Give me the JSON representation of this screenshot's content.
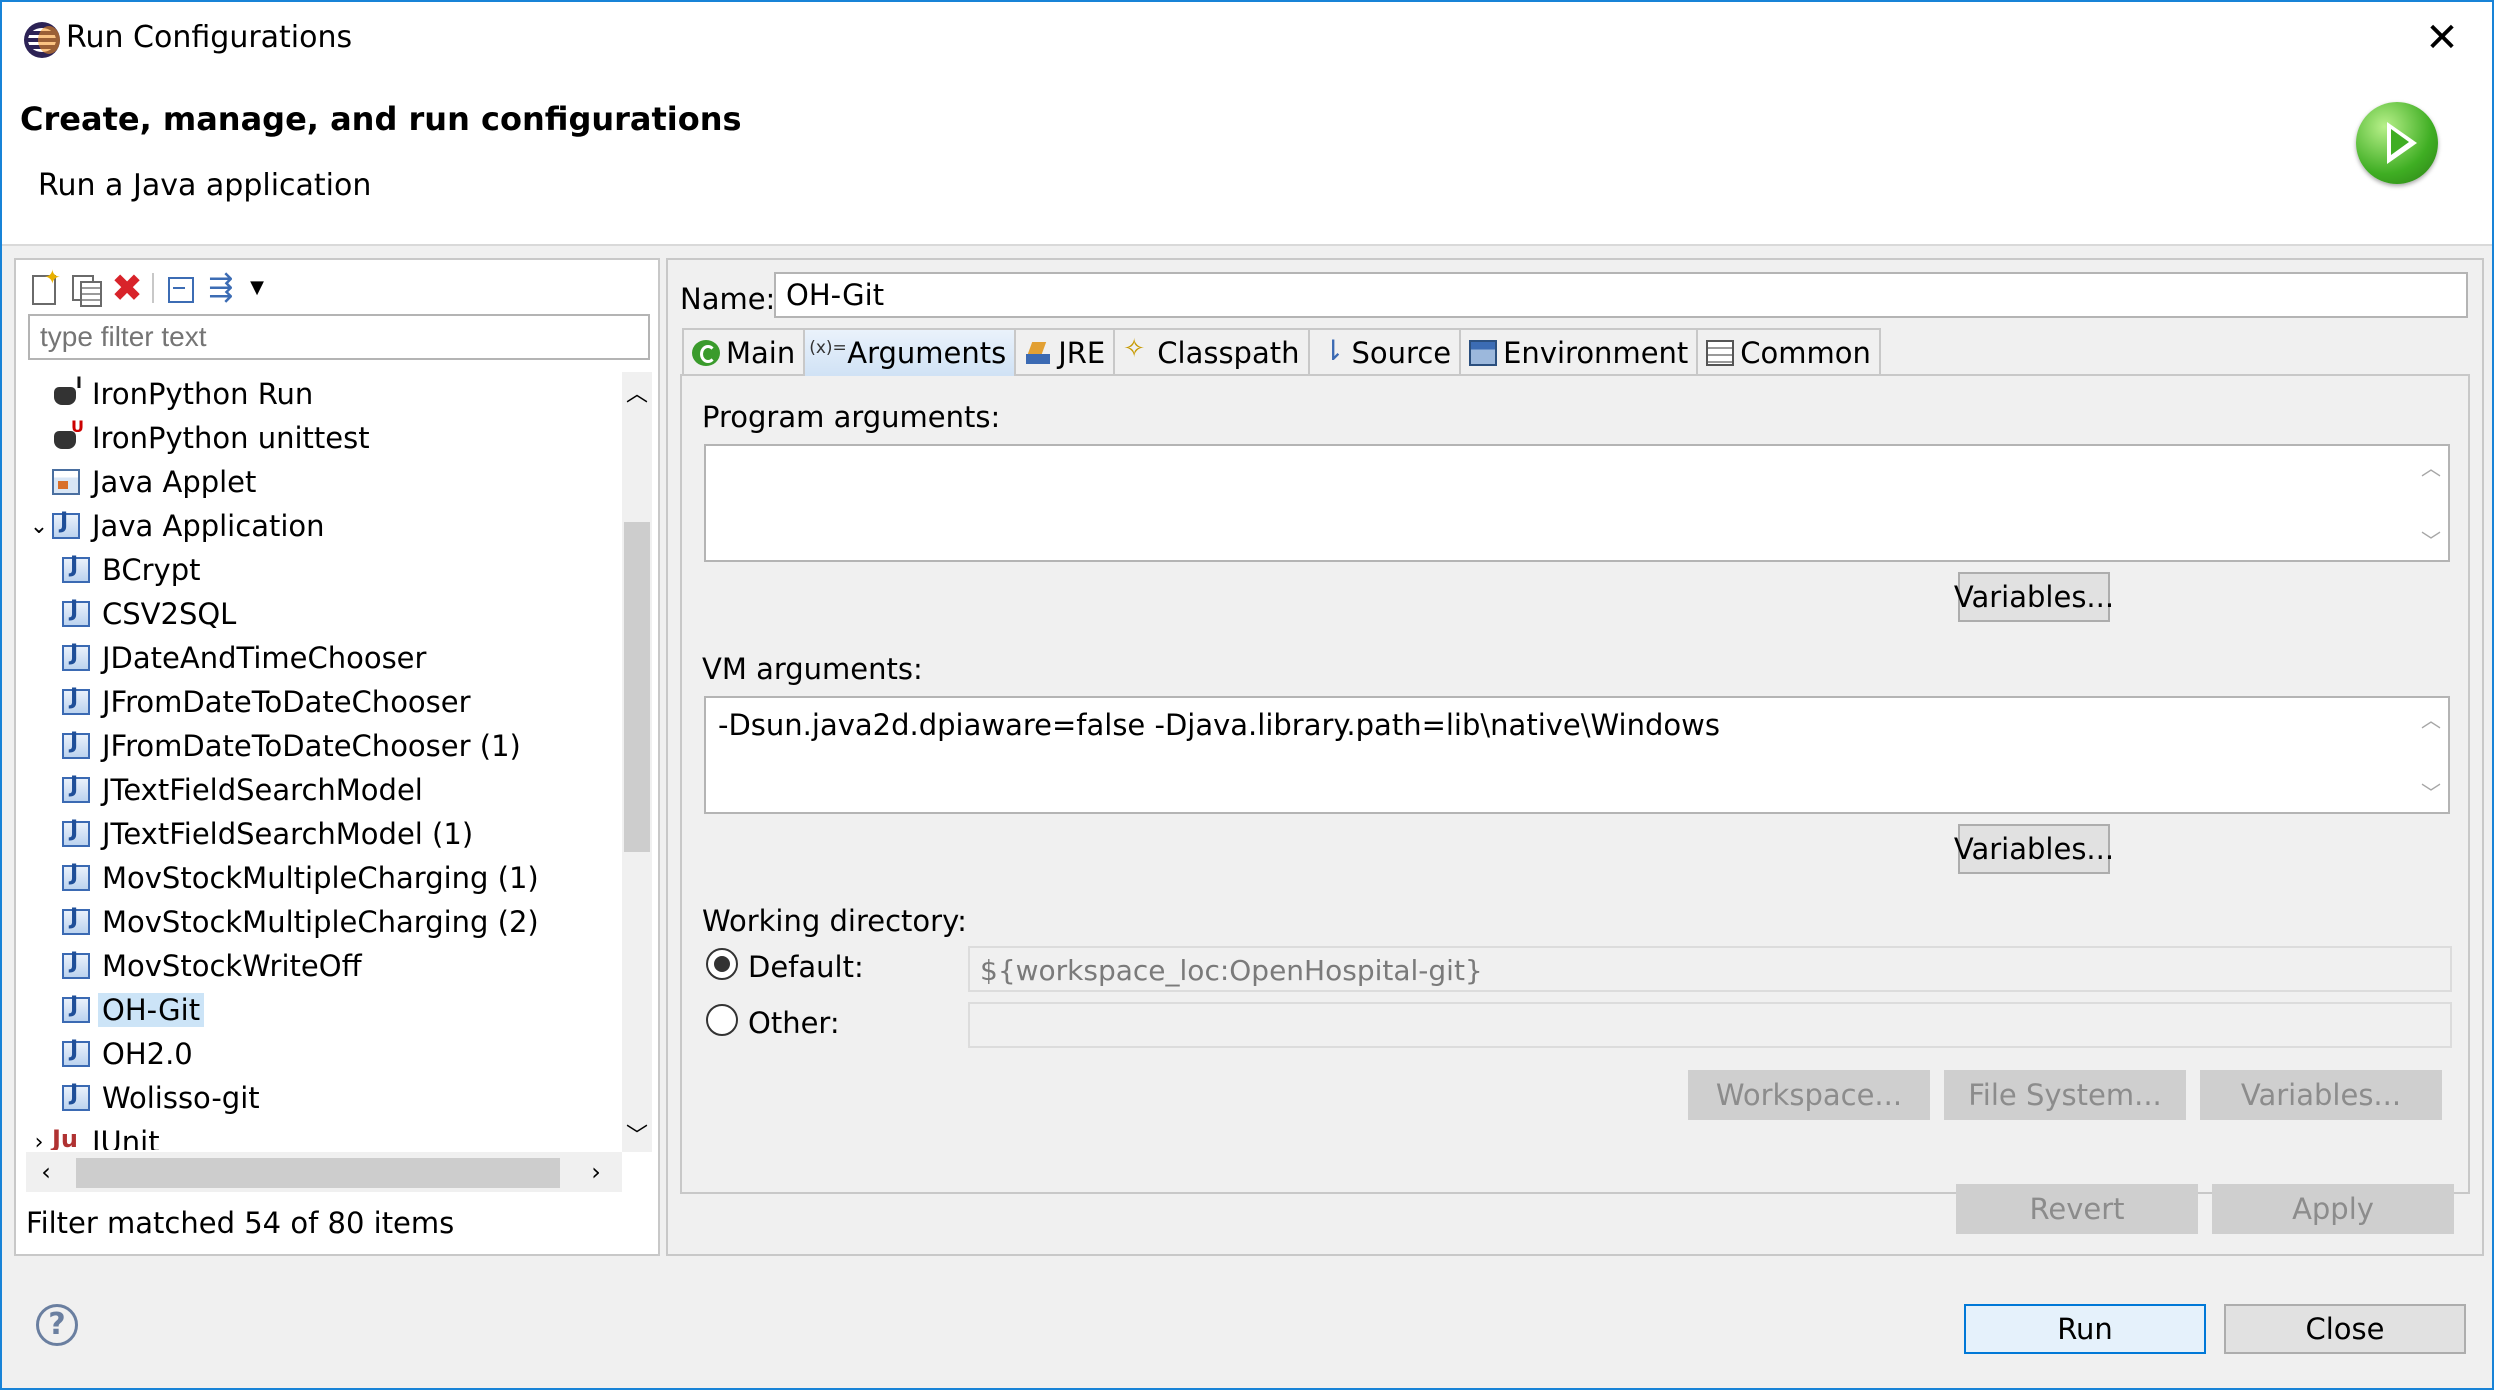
{
  "window": {
    "title": "Run Configurations",
    "close_glyph": "✕"
  },
  "header": {
    "title": "Create, manage, and run configurations",
    "subtitle": "Run a Java application"
  },
  "left": {
    "filter_placeholder": "type filter text",
    "tree": [
      {
        "label": "IronPython Run",
        "icon": "ironpython-icon"
      },
      {
        "label": "IronPython unittest",
        "icon": "ironpython-unittest-icon"
      },
      {
        "label": "Java Applet",
        "icon": "java-applet-icon"
      },
      {
        "label": "Java Application",
        "icon": "java-application-icon",
        "expanded": true
      },
      {
        "label": "BCrypt",
        "icon": "java-file-icon"
      },
      {
        "label": "CSV2SQL",
        "icon": "java-file-icon"
      },
      {
        "label": "JDateAndTimeChooser",
        "icon": "java-file-icon"
      },
      {
        "label": "JFromDateToDateChooser",
        "icon": "java-file-icon"
      },
      {
        "label": "JFromDateToDateChooser (1)",
        "icon": "java-file-icon"
      },
      {
        "label": "JTextFieldSearchModel",
        "icon": "java-file-icon"
      },
      {
        "label": "JTextFieldSearchModel (1)",
        "icon": "java-file-icon"
      },
      {
        "label": "MovStockMultipleCharging (1)",
        "icon": "java-file-icon"
      },
      {
        "label": "MovStockMultipleCharging (2)",
        "icon": "java-file-icon"
      },
      {
        "label": "MovStockWriteOff",
        "icon": "java-file-icon"
      },
      {
        "label": "OH-Git",
        "icon": "java-file-icon",
        "selected": true
      },
      {
        "label": "OH2.0",
        "icon": "java-file-icon"
      },
      {
        "label": "Wolisso-git",
        "icon": "java-file-icon"
      },
      {
        "label": "JUnit",
        "icon": "junit-icon",
        "expanded": false
      }
    ],
    "status": "Filter matched 54 of 80 items"
  },
  "config": {
    "name_label": "Name:",
    "name_value": "OH-Git",
    "tabs": [
      {
        "label": "Main",
        "icon": "main-tab-icon"
      },
      {
        "label": "Arguments",
        "icon": "arguments-tab-icon",
        "active": true
      },
      {
        "label": "JRE",
        "icon": "jre-tab-icon"
      },
      {
        "label": "Classpath",
        "icon": "classpath-tab-icon"
      },
      {
        "label": "Source",
        "icon": "source-tab-icon"
      },
      {
        "label": "Environment",
        "icon": "environment-tab-icon"
      },
      {
        "label": "Common",
        "icon": "common-tab-icon"
      }
    ],
    "program_args_label": "Program arguments:",
    "program_args_value": "",
    "vm_args_label": "VM arguments:",
    "vm_args_value": "-Dsun.java2d.dpiaware=false -Djava.library.path=lib\\native\\Windows",
    "variables_label": "Variables...",
    "working_dir_label": "Working directory:",
    "default_label": "Default:",
    "default_value": "${workspace_loc:OpenHospital-git}",
    "other_label": "Other:",
    "other_value": "",
    "workspace_btn": "Workspace...",
    "filesystem_btn": "File System...",
    "revert_btn": "Revert",
    "apply_btn": "Apply"
  },
  "footer": {
    "run_btn": "Run",
    "close_btn": "Close",
    "help_glyph": "?"
  }
}
